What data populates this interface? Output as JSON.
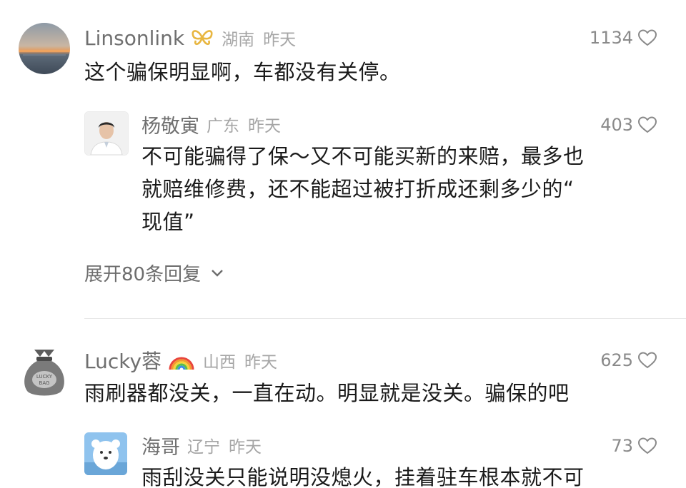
{
  "comments": [
    {
      "user": "Linsonlink",
      "region": "湖南",
      "time": "昨天",
      "likes": "1134",
      "text": "这个骗保明显啊，车都没有关停。",
      "badge_icon": "butterfly-badge-icon",
      "reply": {
        "user": "杨敬寅",
        "region": "广东",
        "time": "昨天",
        "likes": "403",
        "text_lines": [
          "不可能骗得了保～又不可能买新的来赔，最多也",
          "就赔维修费，还不能超过被打折成还剩多少的“",
          "现值”"
        ]
      },
      "expand_label": "展开80条回复"
    },
    {
      "user": "Lucky蓉",
      "region": "山西",
      "time": "昨天",
      "likes": "625",
      "text": "雨刷器都没关，一直在动。明显就是没关。骗保的吧",
      "badge_icon": "rainbow-badge-icon",
      "avatar_text": [
        "LUCKY",
        "BAG"
      ],
      "reply": {
        "user": "海哥",
        "region": "辽宁",
        "time": "昨天",
        "likes": "73",
        "text_lines": [
          "雨刮没关只能说明没熄火，挂着驻车根本就不可"
        ]
      }
    }
  ],
  "colors": {
    "name": "#6f6f6f",
    "meta": "#a6a6a6",
    "text": "#1a1a1a",
    "divider": "#e6e6e6"
  }
}
